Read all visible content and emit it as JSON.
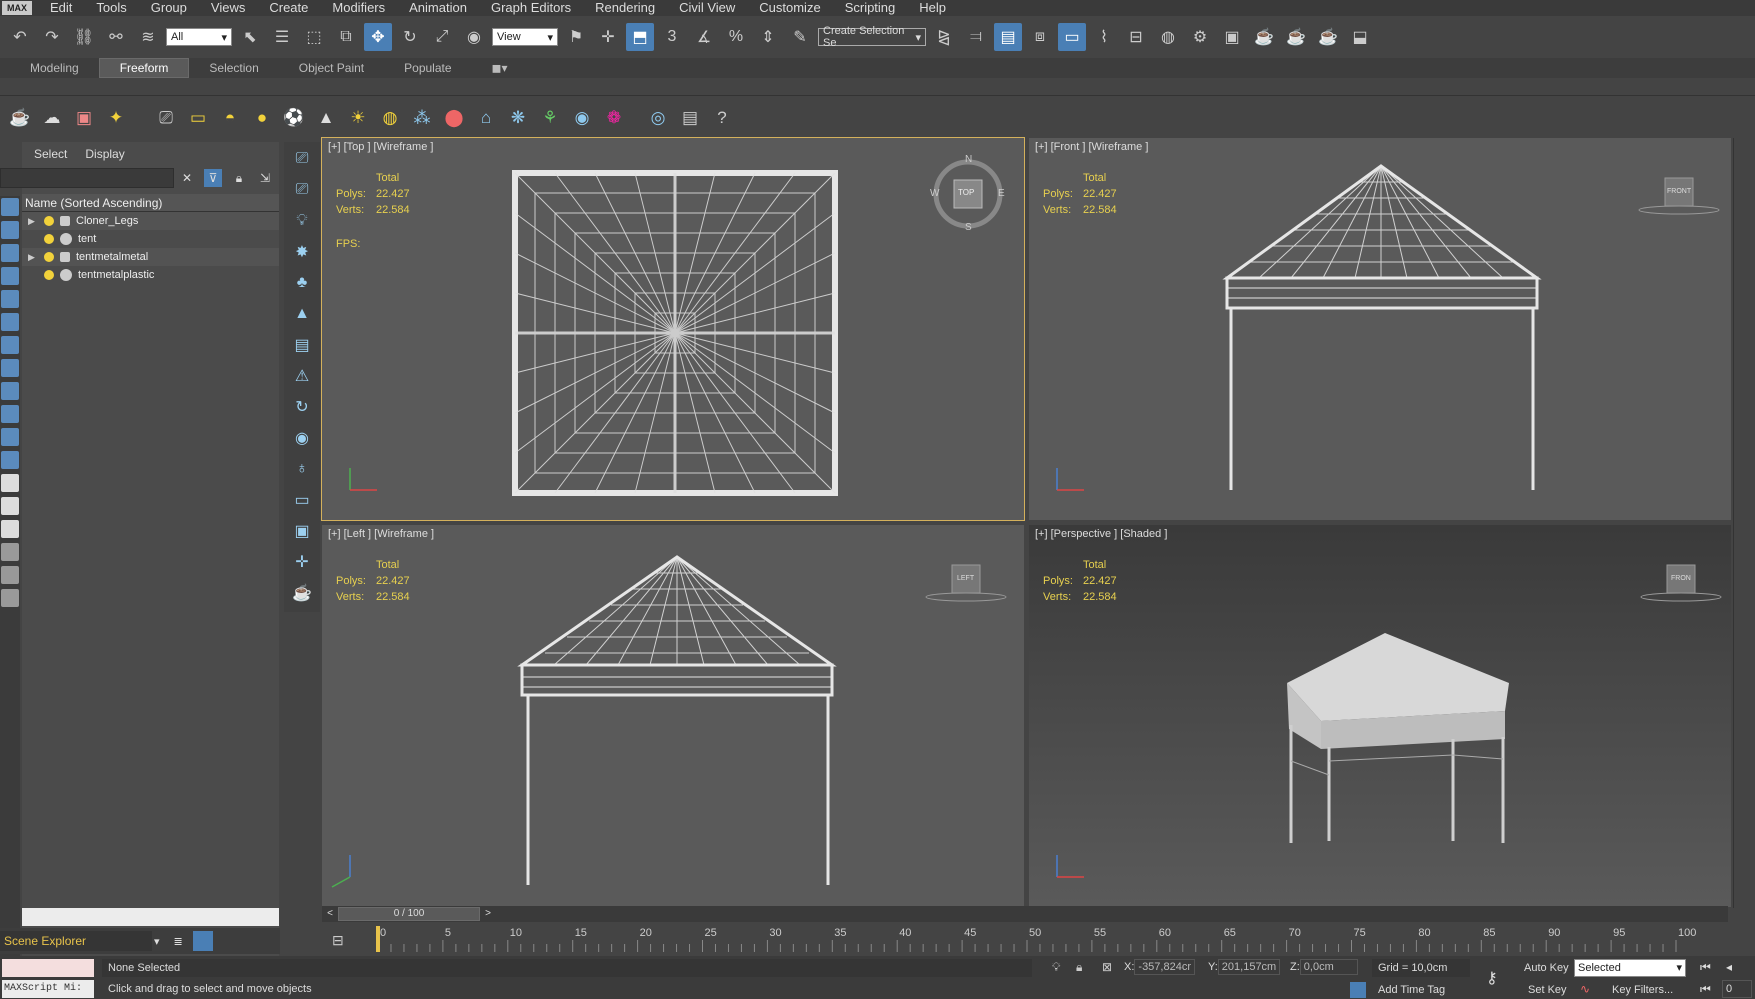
{
  "menu": {
    "logo": "MAX",
    "items": [
      "Edit",
      "Tools",
      "Group",
      "Views",
      "Create",
      "Modifiers",
      "Animation",
      "Graph Editors",
      "Rendering",
      "Civil View",
      "Customize",
      "Scripting",
      "Help"
    ]
  },
  "toolbar": {
    "selection_filter": "All",
    "ref_coord": "View",
    "named_selection": "Create Selection Se"
  },
  "ribbon": {
    "tabs": [
      "Modeling",
      "Freeform",
      "Selection",
      "Object Paint",
      "Populate"
    ],
    "active_tab": "Freeform"
  },
  "scene_explorer": {
    "tabs": [
      "Select",
      "Display"
    ],
    "column_header": "Name (Sorted Ascending)",
    "objects": [
      {
        "name": "Cloner_Legs",
        "expandable": true
      },
      {
        "name": "tent",
        "expandable": false
      },
      {
        "name": "tentmetalmetal",
        "expandable": true
      },
      {
        "name": "tentmetalplastic",
        "expandable": false
      }
    ],
    "title": "Scene Explorer"
  },
  "viewports": {
    "top": {
      "label": "[+] [Top ] [Wireframe ]",
      "cube": "TOP",
      "compass": {
        "n": "N",
        "s": "S",
        "e": "E",
        "w": "W"
      }
    },
    "front": {
      "label": "[+] [Front ] [Wireframe ]",
      "cube": "FRONT"
    },
    "left": {
      "label": "[+] [Left ] [Wireframe ]",
      "cube": "LEFT"
    },
    "perspective": {
      "label": "[+] [Perspective ] [Shaded ]",
      "cube": "FRON"
    },
    "stats": {
      "total": "Total",
      "polys_label": "Polys:",
      "polys": "22.427",
      "verts_label": "Verts:",
      "verts": "22.584",
      "fps_label": "FPS:"
    }
  },
  "timeline": {
    "frame_display": "0 / 100",
    "prev": "<",
    "next": ">",
    "ticks": [
      "0",
      "5",
      "10",
      "15",
      "20",
      "25",
      "30",
      "35",
      "40",
      "45",
      "50",
      "55",
      "60",
      "65",
      "70",
      "75",
      "80",
      "85",
      "90",
      "95",
      "100"
    ]
  },
  "status": {
    "maxscript": "MAXScript Mi:",
    "selection": "None Selected",
    "prompt": "Click and drag to select and move objects",
    "x_label": "X:",
    "x_value": "-357,824cr",
    "y_label": "Y:",
    "y_value": "201,157cm",
    "z_label": "Z:",
    "z_value": "0,0cm",
    "grid": "Grid = 10,0cm",
    "add_time_tag": "Add Time Tag",
    "auto_key": "Auto Key",
    "set_key": "Set Key",
    "key_mode": "Selected",
    "key_filters": "Key Filters...",
    "frame": "0"
  }
}
